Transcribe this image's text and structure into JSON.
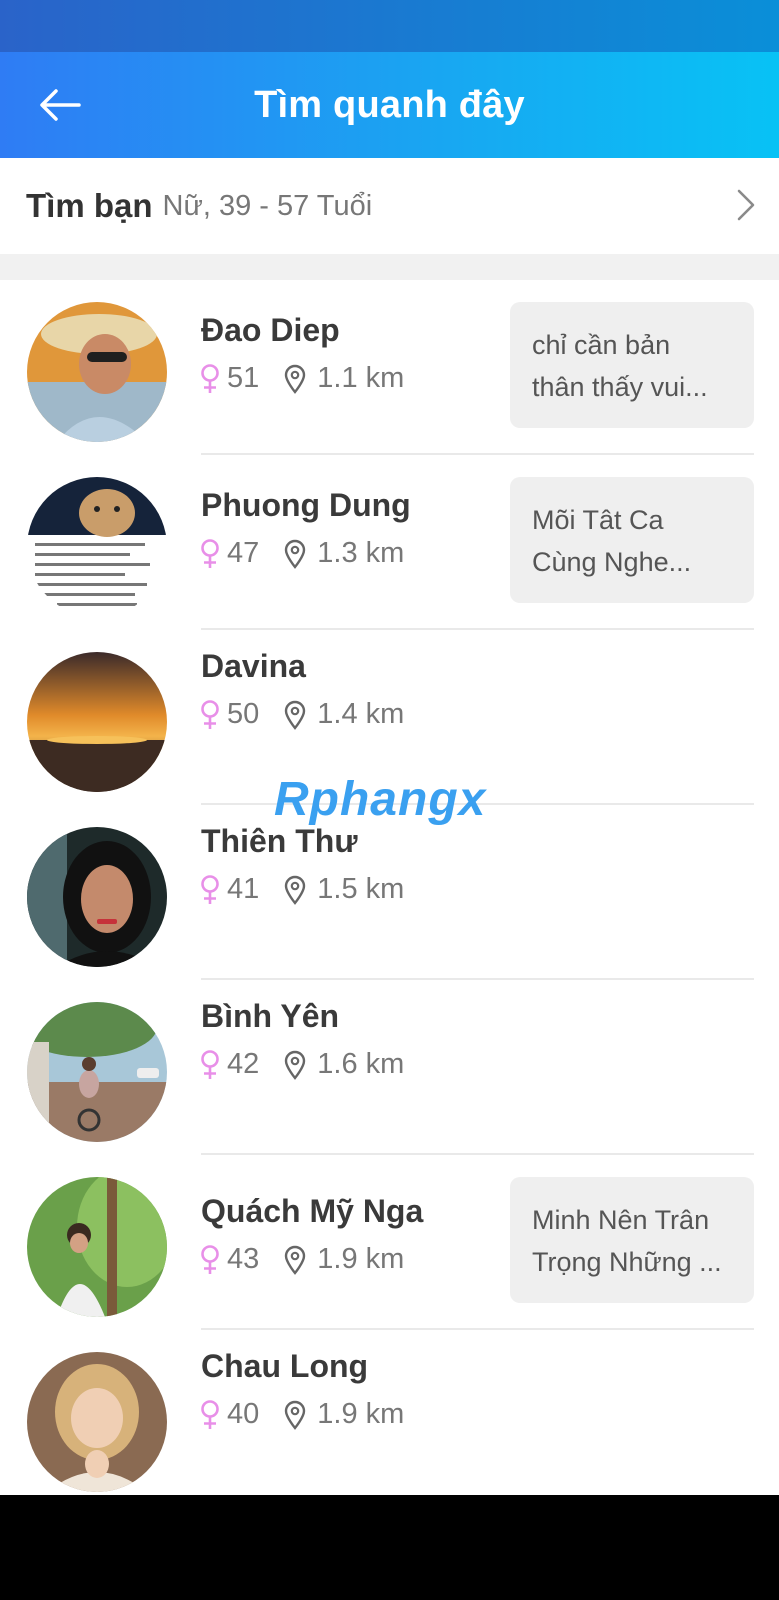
{
  "header": {
    "title": "Tìm quanh đây",
    "back_icon": "arrow-left-icon"
  },
  "filter": {
    "title": "Tìm bạn",
    "detail": "Nữ, 39 - 57 Tuổi",
    "chevron_icon": "chevron-right-icon"
  },
  "users": [
    {
      "name": "Đao Diep",
      "age": "51",
      "distance": "1.1 km",
      "status_line1": "chỉ cần bản",
      "status_line2": "thân thấy vui..."
    },
    {
      "name": "Phuong Dung",
      "age": "47",
      "distance": "1.3 km",
      "status_line1": "Mõi Tât Ca",
      "status_line2": "Cùng Nghe..."
    },
    {
      "name": "Davina",
      "age": "50",
      "distance": "1.4 km"
    },
    {
      "name": "Thiên Thư",
      "age": "41",
      "distance": "1.5 km"
    },
    {
      "name": "Bình Yên",
      "age": "42",
      "distance": "1.6 km"
    },
    {
      "name": "Quách Mỹ Nga",
      "age": "43",
      "distance": "1.9 km",
      "status_line1": "Minh Nên Trân",
      "status_line2": "Trọng Những ..."
    },
    {
      "name": "Chau Long",
      "age": "40",
      "distance": "1.9 km"
    }
  ],
  "watermark": {
    "text": "Rphangx"
  },
  "colors": {
    "header_gradient_start": "#2f7cf4",
    "header_gradient_end": "#08c2f5",
    "female_icon": "#e88fe8",
    "bubble_bg": "#efefef"
  }
}
